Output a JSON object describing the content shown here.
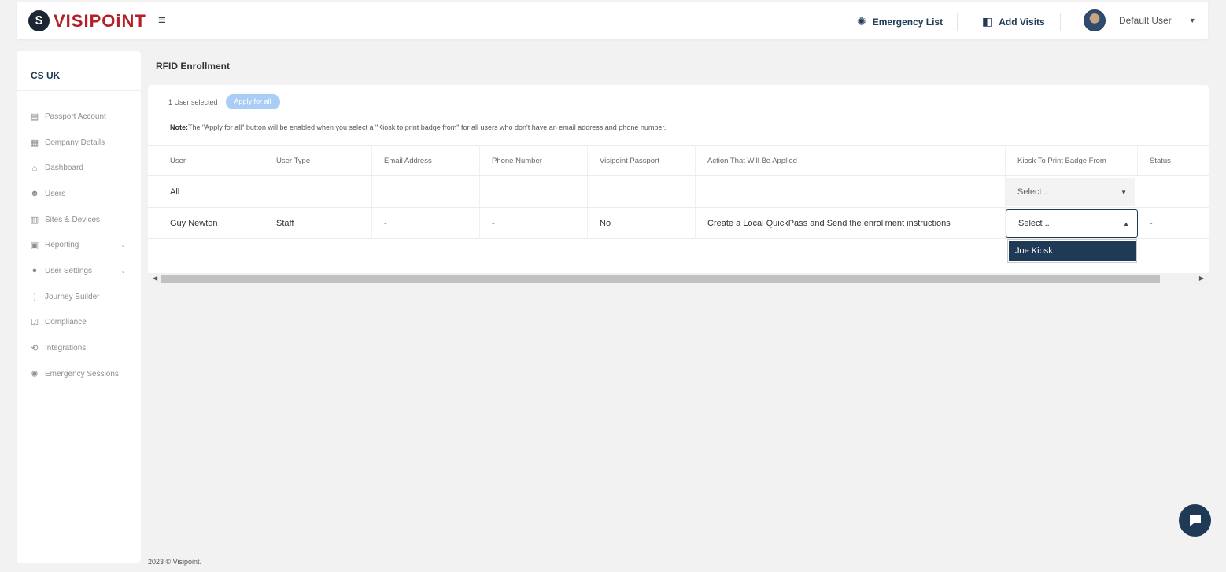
{
  "brand": {
    "logo_text": "VISIPOiNT",
    "logo_mark": "$"
  },
  "header": {
    "menu_icon": "hamburger-icon",
    "emergency_list": "Emergency List",
    "add_visits": "Add Visits",
    "user_name": "Default User"
  },
  "sidebar": {
    "org": "CS UK",
    "items": [
      {
        "label": "Passport Account",
        "icon": "passport-icon",
        "glyph": "▤"
      },
      {
        "label": "Company Details",
        "icon": "building-icon",
        "glyph": "▦"
      },
      {
        "label": "Dashboard",
        "icon": "home-icon",
        "glyph": "⌂"
      },
      {
        "label": "Users",
        "icon": "users-icon",
        "glyph": "☻"
      },
      {
        "label": "Sites & Devices",
        "icon": "sites-icon",
        "glyph": "▥"
      },
      {
        "label": "Reporting",
        "icon": "report-icon",
        "glyph": "▣",
        "has_children": true
      },
      {
        "label": "User Settings",
        "icon": "user-settings-icon",
        "glyph": "●",
        "has_children": true
      },
      {
        "label": "Journey Builder",
        "icon": "journey-icon",
        "glyph": "⋮"
      },
      {
        "label": "Compliance",
        "icon": "compliance-icon",
        "glyph": "☑"
      },
      {
        "label": "Integrations",
        "icon": "integrations-icon",
        "glyph": "⟲"
      },
      {
        "label": "Emergency Sessions",
        "icon": "siren-icon",
        "glyph": "✺"
      }
    ]
  },
  "page": {
    "title": "RFID Enrollment",
    "selected_count": "1 User selected",
    "apply_all": "Apply for all",
    "note_label": "Note:",
    "note_text": "The \"Apply for all\" button will be enabled when you select a \"Kiosk to print badge from\" for all users who don't have an email address and phone number."
  },
  "table": {
    "headers": [
      "User",
      "User Type",
      "Email Address",
      "Phone Number",
      "Visipoint Passport",
      "Action That Will Be Applied",
      "Kiosk To Print Badge From",
      "Status"
    ],
    "all_row": {
      "user": "All",
      "select_placeholder": "Select .."
    },
    "rows": [
      {
        "user": "Guy Newton",
        "user_type": "Staff",
        "email": "-",
        "phone": "-",
        "passport": "No",
        "action": "Create a Local QuickPass and Send the enrollment instructions",
        "kiosk": "Select ..",
        "status": "-"
      }
    ],
    "dropdown_options": [
      "Joe Kiosk"
    ]
  },
  "footer": {
    "text": "2023 © Visipoint."
  },
  "colors": {
    "primary": "#1f3a56",
    "brand_red": "#b3202a",
    "apply_disabled": "#a9cdf5"
  }
}
